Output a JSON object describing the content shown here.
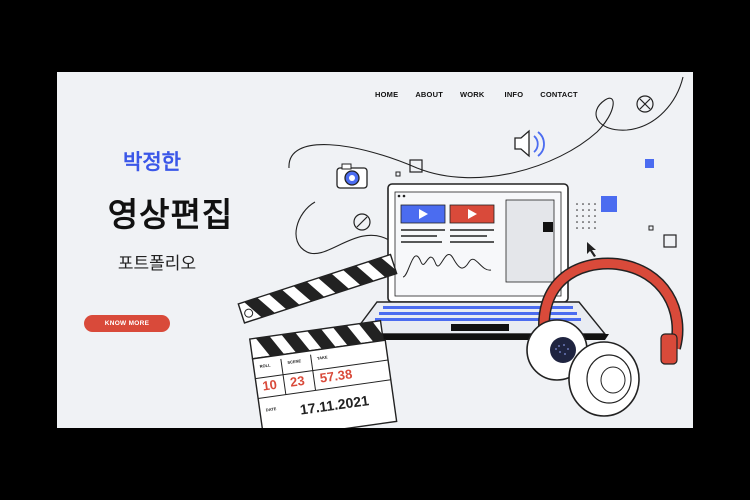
{
  "nav": {
    "items": [
      "HOME",
      "ABOUT",
      "WORK",
      "INFO",
      "CONTACT"
    ]
  },
  "hero": {
    "name": "박정한",
    "title": "영상편집",
    "subtitle": "포트폴리오",
    "cta": "KNOW MORE"
  },
  "clapper": {
    "header_labels": [
      "ROLL",
      "SCENE",
      "TAKE"
    ],
    "roll": "10",
    "scene": "23",
    "take": "57.38",
    "date_label": "DATE",
    "date": "17.11.2021"
  },
  "colors": {
    "accent_blue": "#3b57e8",
    "accent_red": "#d94a3a",
    "background": "#f0f2f5",
    "frame": "#000000"
  },
  "icons": [
    "camera-icon",
    "speaker-icon",
    "close-circle-icon",
    "no-icon",
    "cursor-icon",
    "play-icon",
    "square-icon"
  ]
}
